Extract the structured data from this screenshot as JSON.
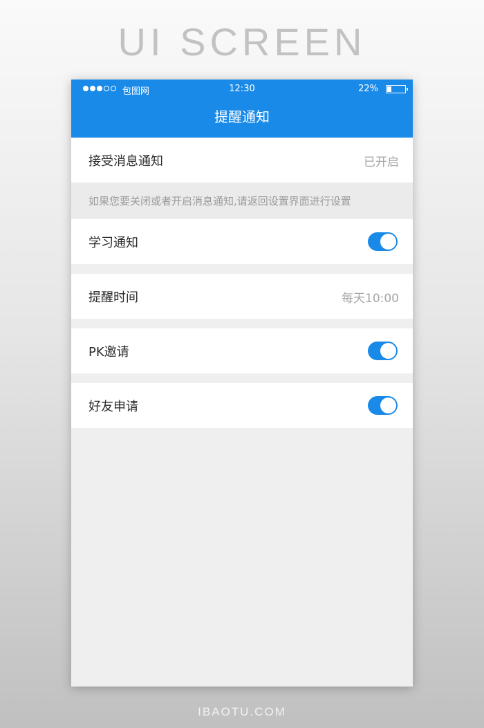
{
  "page": {
    "headline": "UI SCREEN",
    "footer": "IBAOTU.COM"
  },
  "status_bar": {
    "signal_dots_filled": 3,
    "signal_dots_total": 5,
    "carrier": "包图网",
    "time": "12:30",
    "battery_text": "22%",
    "battery_level": 0.22
  },
  "header": {
    "title": "提醒通知"
  },
  "settings": {
    "receive_notifications": {
      "label": "接受消息通知",
      "value": "已开启"
    },
    "hint": "如果您要关闭或者开启消息通知,请返回设置界面进行设置",
    "study_notification": {
      "label": "学习通知",
      "enabled": true
    },
    "reminder_time": {
      "label": "提醒时间",
      "value": "每天10:00"
    },
    "pk_invite": {
      "label": "PK邀请",
      "enabled": true
    },
    "friend_request": {
      "label": "好友申请",
      "enabled": true
    }
  },
  "colors": {
    "accent": "#1a8ae8",
    "row_background": "#ffffff",
    "screen_background": "#efefef",
    "secondary_text": "#a6a6a6"
  }
}
